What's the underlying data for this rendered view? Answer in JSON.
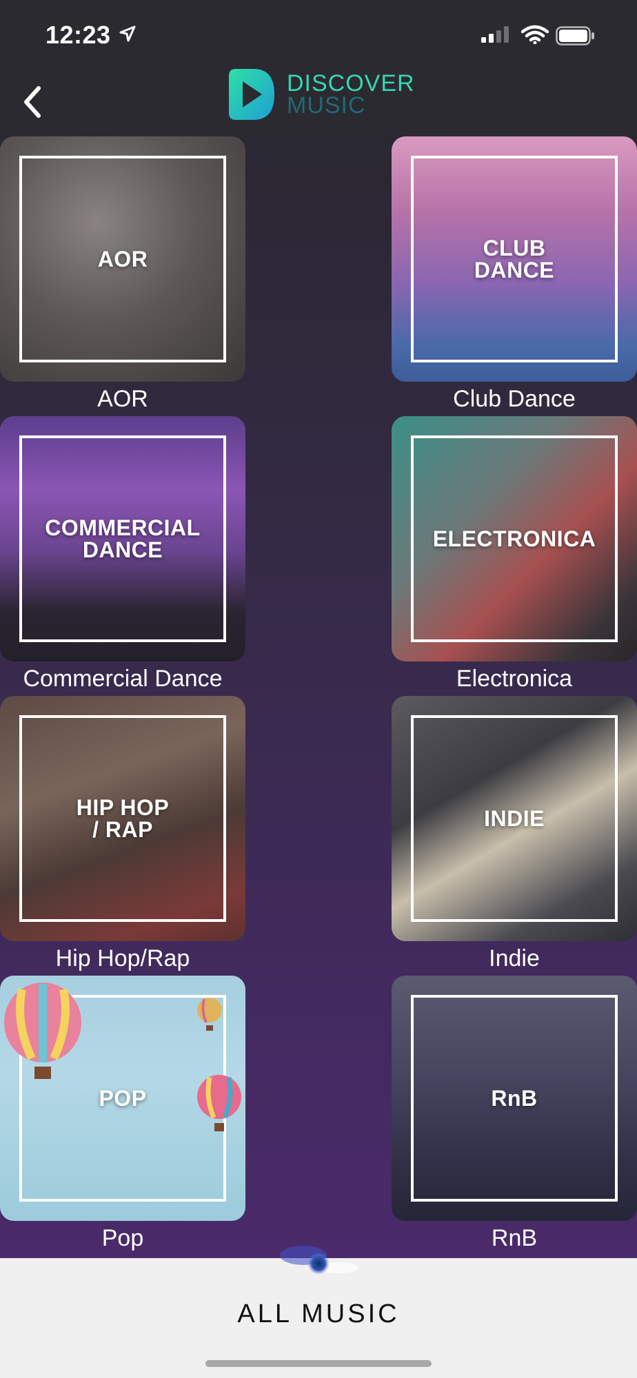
{
  "status_bar": {
    "time": "12:23"
  },
  "header": {
    "logo_line1": "DISCOVER",
    "logo_line2": "MUSIC"
  },
  "genres": [
    {
      "overlay": "AOR",
      "caption": "AOR"
    },
    {
      "overlay": "CLUB\nDANCE",
      "caption": "Club Dance"
    },
    {
      "overlay": "COMMERCIAL\nDANCE",
      "caption": "Commercial Dance"
    },
    {
      "overlay": "ELECTRONICA",
      "caption": "Electronica"
    },
    {
      "overlay": "HIP HOP\n/ RAP",
      "caption": "Hip Hop/Rap"
    },
    {
      "overlay": "INDIE",
      "caption": "Indie"
    },
    {
      "overlay": "POP",
      "caption": "Pop"
    },
    {
      "overlay": "RnB",
      "caption": "RnB"
    }
  ],
  "footer": {
    "all_music_label": "ALL MUSIC"
  },
  "colors": {
    "logo_teal": "#36d7b0",
    "logo_dark": "#1f6a73",
    "background_top": "#2a2832",
    "background_bottom": "#4a2a6a",
    "footer_bg": "#f0f0f0"
  }
}
